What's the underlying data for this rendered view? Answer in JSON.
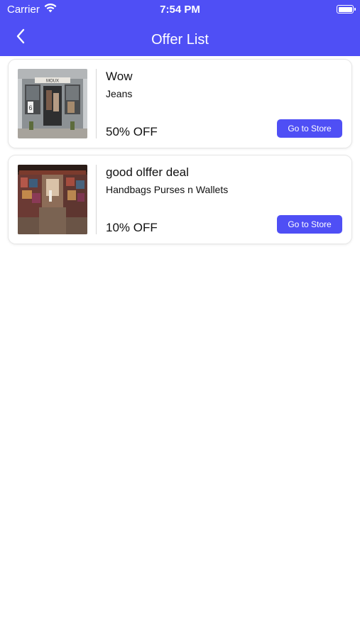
{
  "status_bar": {
    "carrier": "Carrier",
    "time": "7:54 PM",
    "icons": [
      "wifi-icon",
      "battery-icon"
    ]
  },
  "header": {
    "title": "Offer List",
    "back_icon": "chevron-left-icon",
    "background": "#4f4ff5"
  },
  "offers": [
    {
      "title": "Wow",
      "category": "Jeans",
      "discount": "50% OFF",
      "button_label": "Go to Store",
      "image": "storefront-photo",
      "store_sign": "MOUX"
    },
    {
      "title": "good olffer deal",
      "category": "Handbags Purses n Wallets",
      "discount": "10% OFF",
      "button_label": "Go to Store",
      "image": "market-interior-photo"
    }
  ],
  "colors": {
    "accent": "#4f4ff5",
    "card_border": "#e6e6e6"
  }
}
